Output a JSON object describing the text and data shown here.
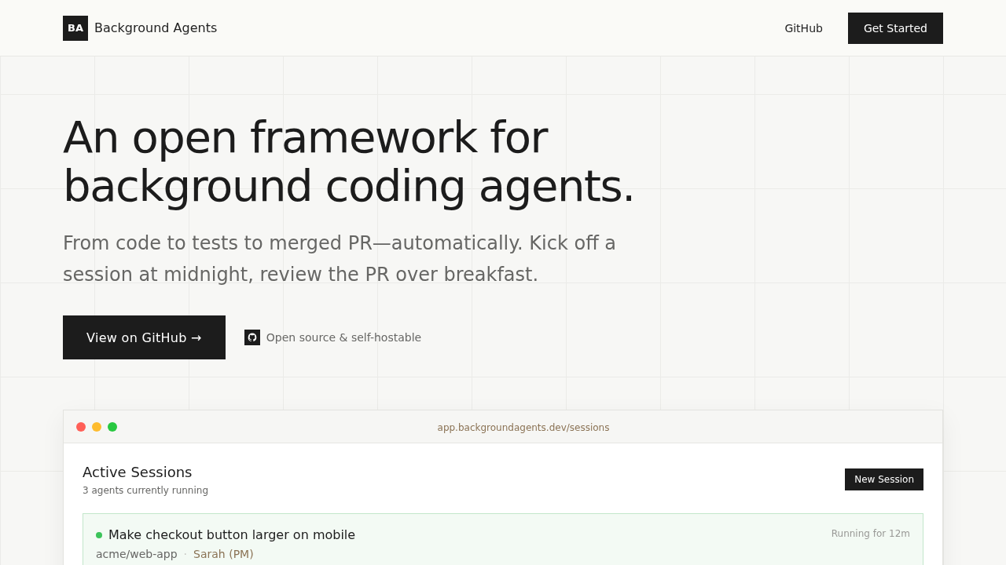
{
  "header": {
    "logo": "BA",
    "brand": "Background Agents",
    "nav": [
      {
        "label": "GitHub",
        "kind": "link"
      },
      {
        "label": "Get Started",
        "kind": "button"
      }
    ]
  },
  "hero": {
    "title_lines": [
      "An open framework for",
      "background coding agents."
    ],
    "subtitle": "From code to tests to merged PR—automatically. Kick off a session at midnight, review the PR over breakfast.",
    "primary_button": "View on GitHub →",
    "note": "Open source & self-hostable"
  },
  "preview": {
    "window_controls": [
      {
        "color": "#ff5f57"
      },
      {
        "color": "#febc2e"
      },
      {
        "color": "#28c840"
      }
    ],
    "url": "app.backgroundagents.dev/sessions",
    "title": "Active Sessions",
    "subtitle": "3 agents currently running",
    "button": "New Session",
    "sessions": [
      {
        "title": "Make checkout button larger on mobile",
        "running": true,
        "duration": "Running for 12m",
        "repo": "acme/web-app",
        "separator": "·",
        "requester": "Sarah (PM)"
      }
    ]
  }
}
